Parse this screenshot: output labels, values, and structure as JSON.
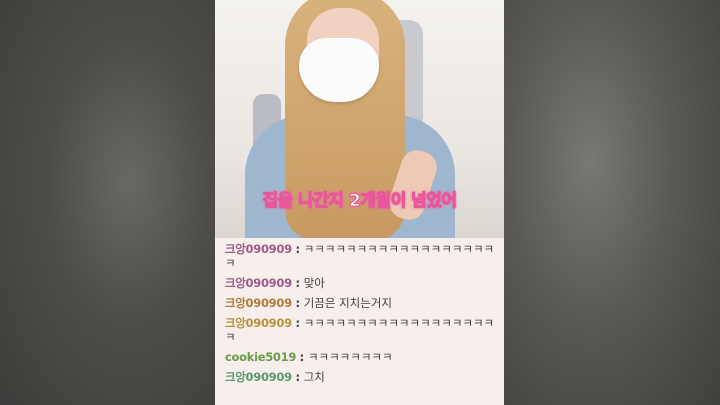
{
  "video": {
    "subtitle": "집을 나간지 2개월이 넘었어"
  },
  "chat": {
    "messages": [
      {
        "nick": "크앙090909",
        "sep": ":",
        "text": "ㅋㅋㅋㅋㅋㅋㅋㅋㅋㅋㅋㅋㅋㅋㅋㅋㅋㅋㅋ",
        "color": "#a05a8a"
      },
      {
        "nick": "크앙090909",
        "sep": ":",
        "text": "맞아",
        "color": "#a05a8a"
      },
      {
        "nick": "크앙090909",
        "sep": ":",
        "text": "기끔은 지치는거지",
        "color": "#b07a3a"
      },
      {
        "nick": "크앙090909",
        "sep": ":",
        "text": "ㅋㅋㅋㅋㅋㅋㅋㅋㅋㅋㅋㅋㅋㅋㅋㅋㅋㅋㅋ",
        "color": "#b8903a"
      },
      {
        "nick": "cookie5019",
        "sep": ":",
        "text": "ㅋㅋㅋㅋㅋㅋㅋㅋ",
        "color": "#6a9a4a"
      },
      {
        "nick": "크앙090909",
        "sep": ":",
        "text": "그치",
        "color": "#5a9a6a"
      }
    ]
  }
}
